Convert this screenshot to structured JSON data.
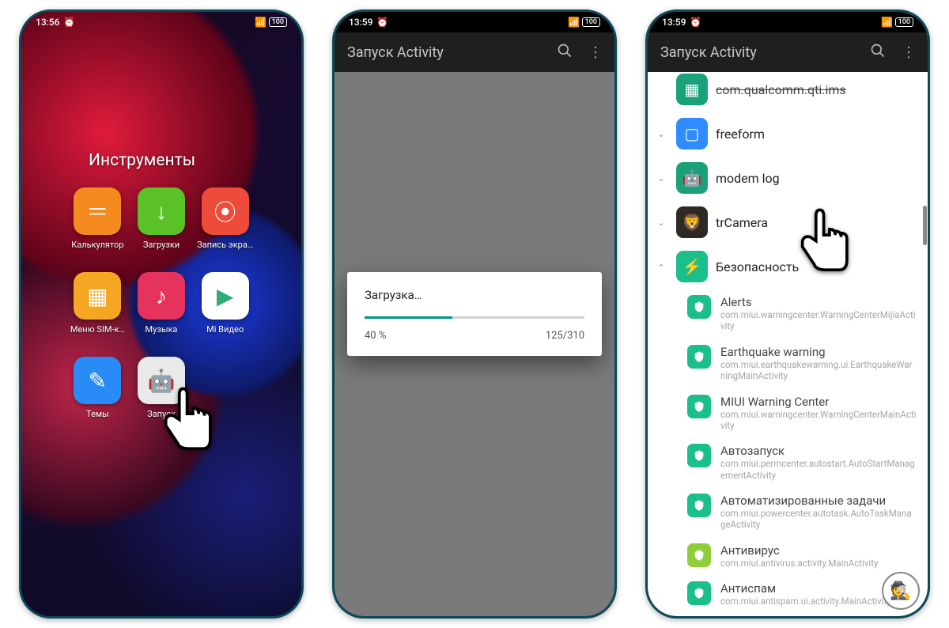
{
  "phone1": {
    "status": {
      "time": "13:56",
      "battery": "100"
    },
    "folder_title": "Инструменты",
    "apps": [
      {
        "label": "Калькулятор",
        "color": "#f58a1f",
        "glyph": "＝"
      },
      {
        "label": "Загрузки",
        "color": "#5ac227",
        "glyph": "↓"
      },
      {
        "label": "Запись экра…",
        "color": "#ee4b3a",
        "glyph": "⦿"
      },
      {
        "label": "Меню SIM-к…",
        "color": "#f5a623",
        "glyph": "▦"
      },
      {
        "label": "Музыка",
        "color": "#e5335d",
        "glyph": "♪"
      },
      {
        "label": "Mi Видео",
        "color": "#ffffff",
        "glyph": "▶"
      },
      {
        "label": "Темы",
        "color": "#2a8af6",
        "glyph": "✎"
      },
      {
        "label": "Запуск",
        "color": "#e9e9e9",
        "glyph": "🤖"
      }
    ]
  },
  "phone2": {
    "status": {
      "time": "13:59",
      "battery": "100"
    },
    "appbar_title": "Запуск Activity",
    "dialog": {
      "title": "Загрузка…",
      "percent_text": "40 %",
      "percent_value": 40,
      "count_text": "125/310"
    }
  },
  "phone3": {
    "status": {
      "time": "13:59",
      "battery": "100"
    },
    "appbar_title": "Запуск Activity",
    "truncated_top": "com.qualcomm.qti.ims",
    "rows": [
      {
        "label": "freeform",
        "icon_bg": "#2f8cff",
        "icon": "▢",
        "expanded": false
      },
      {
        "label": "modem log",
        "icon_bg": "#1aa17a",
        "icon": "🤖",
        "expanded": false
      },
      {
        "label": "trCamera",
        "icon_bg": "#2d2a24",
        "icon": "🦁",
        "expanded": false
      }
    ],
    "security": {
      "label": "Безопасность",
      "icon_bg": "#1bbf8b",
      "icon": "⚡",
      "items": [
        {
          "title": "Alerts",
          "desc": "com.miui.warningcenter.WarningCenterMijiaActivity",
          "icon_bg": "#1bbf8b"
        },
        {
          "title": "Earthquake warning",
          "desc": "com.miui.earthquakewarning.ui.EarthquakeWarningMainActivity",
          "icon_bg": "#1bbf8b"
        },
        {
          "title": "MIUI Warning Center",
          "desc": "com.miui.warningcenter.WarningCenterMainActivity",
          "icon_bg": "#1bbf8b"
        },
        {
          "title": "Автозапуск",
          "desc": "com.miui.permcenter.autostart.AutoStartManagementActivity",
          "icon_bg": "#1bbf8b"
        },
        {
          "title": "Автоматизированные задачи",
          "desc": "com.miui.powercenter.autotask.AutoTaskManageActivity",
          "icon_bg": "#1bbf8b"
        },
        {
          "title": "Антивирус",
          "desc": "com.miui.antivirus.activity.MainActivity",
          "icon_bg": "#8fce3a"
        },
        {
          "title": "Антиспам",
          "desc": "com.miui.antispam.ui.activity.MainActivity",
          "icon_bg": "#1bbf8b"
        }
      ]
    }
  }
}
